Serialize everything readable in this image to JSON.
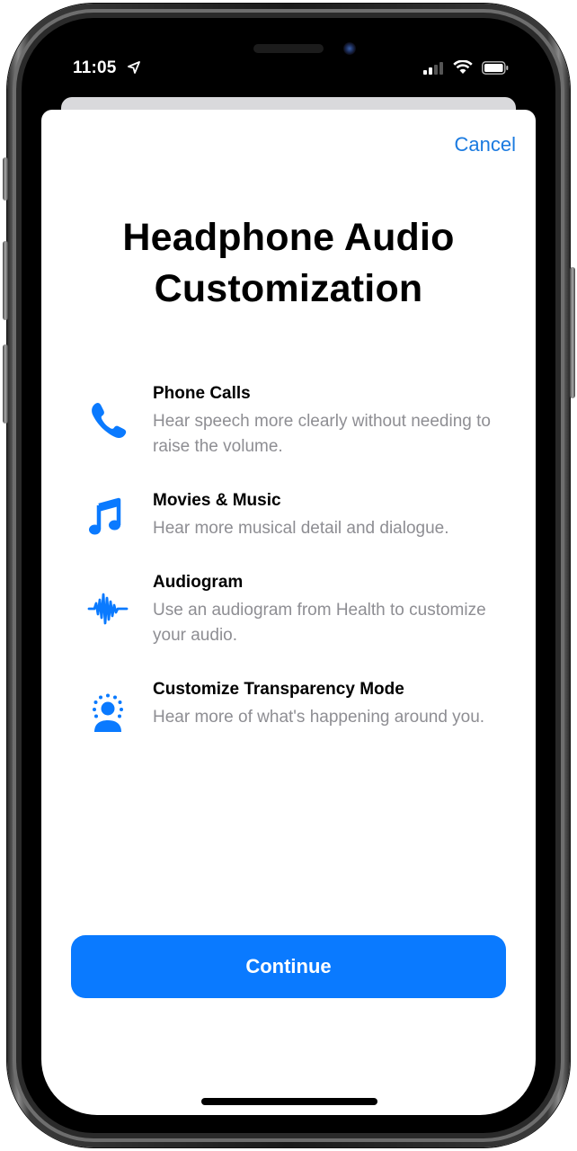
{
  "status_bar": {
    "time": "11:05",
    "location_icon": "location-arrow-icon",
    "signal_icon": "cellular-signal-icon",
    "wifi_icon": "wifi-icon",
    "battery_icon": "battery-icon"
  },
  "sheet": {
    "cancel_label": "Cancel",
    "title_line1": "Headphone Audio",
    "title_line2": "Customization",
    "features": [
      {
        "icon": "phone-icon",
        "title": "Phone Calls",
        "description": "Hear speech more clearly without needing to raise the volume."
      },
      {
        "icon": "music-note-icon",
        "title": "Movies & Music",
        "description": "Hear more musical detail and dialogue."
      },
      {
        "icon": "waveform-icon",
        "title": "Audiogram",
        "description": "Use an audiogram from Health to customize your audio."
      },
      {
        "icon": "transparency-person-icon",
        "title": "Customize Transparency Mode",
        "description": "Hear more of what's happening around you."
      }
    ],
    "continue_label": "Continue"
  },
  "colors": {
    "accent": "#0a7aff",
    "link": "#1a7ae0",
    "secondary_text": "#8e8e93"
  }
}
